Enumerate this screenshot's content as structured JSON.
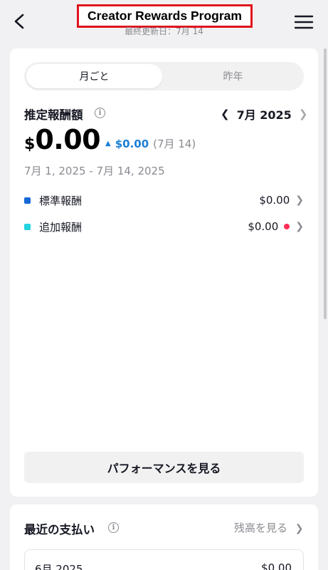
{
  "header": {
    "title": "Creator Rewards Program",
    "updated": "最終更新日：7月 14",
    "back_icon": "chevron-left-icon",
    "menu_icon": "hamburger-menu-icon"
  },
  "tabs": {
    "active": "月ごと",
    "other": "昨年"
  },
  "estimate": {
    "label": "推定報酬額",
    "month": "7月 2025",
    "currency": "$",
    "amount": "0.00",
    "delta_value": "$0.00",
    "delta_date": "(7月 14)",
    "range": "7月 1, 2025 - 7月 14, 2025"
  },
  "breakdown": [
    {
      "label": "標準報酬",
      "amount": "$0.00",
      "color": "#1769d6"
    },
    {
      "label": "追加報酬",
      "amount": "$0.00",
      "color": "#23d3e0"
    }
  ],
  "chart_data": {
    "type": "bar",
    "x_ticks": [
      "1",
      "4",
      "7",
      "10",
      "13",
      "16",
      "19",
      "22",
      "25",
      "28",
      "31"
    ],
    "y_ticks": [
      "0",
      "1",
      "2",
      "3"
    ],
    "ylim": [
      0,
      3
    ],
    "grid": true,
    "series": [
      {
        "values": []
      },
      {
        "values": []
      }
    ]
  },
  "performance_button": "パフォーマンスを見る",
  "payments": {
    "title": "最近の支払い",
    "link": "残高を見る",
    "items": [
      {
        "month": "6月 2025",
        "amount": "$0.00"
      }
    ]
  },
  "colors": {
    "accent_blue": "#1b7fd6",
    "alert_red": "#fe2c55",
    "highlight_border": "#e0131d"
  }
}
